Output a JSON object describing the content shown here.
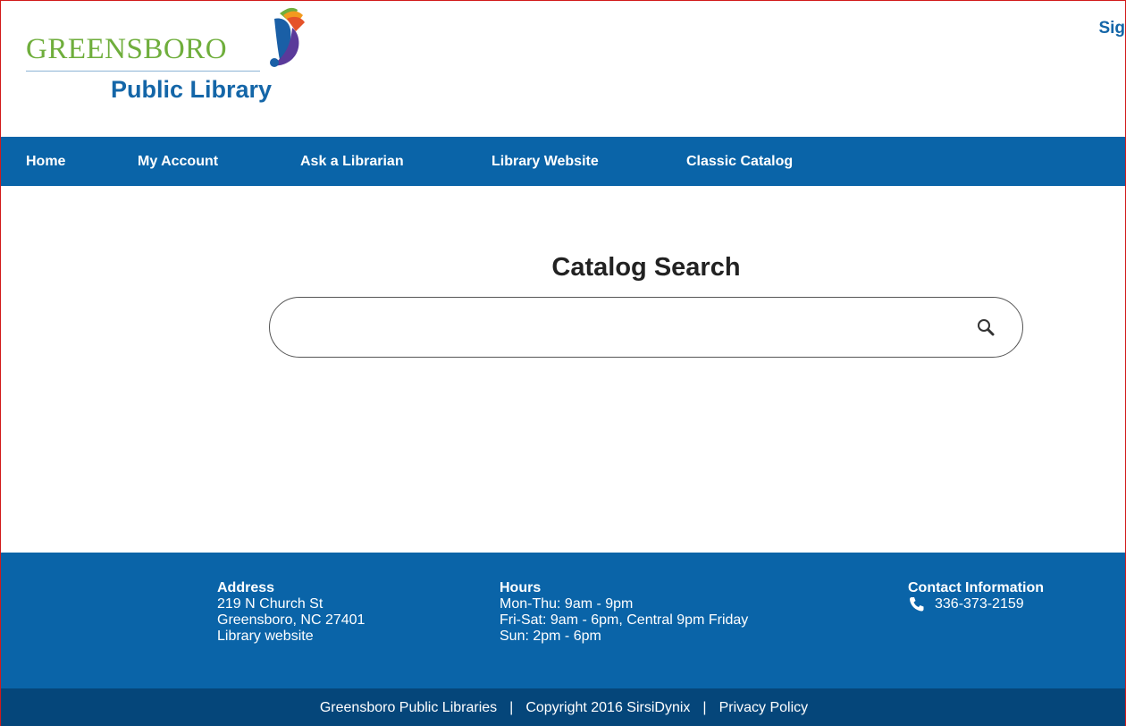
{
  "header": {
    "logo_top": "GREENSBORO",
    "logo_bottom": "Public Library",
    "signin_label": "Sig"
  },
  "nav": {
    "items": [
      {
        "label": "Home"
      },
      {
        "label": "My Account"
      },
      {
        "label": "Ask a Librarian"
      },
      {
        "label": "Library Website"
      },
      {
        "label": "Classic Catalog"
      }
    ]
  },
  "search": {
    "title": "Catalog Search",
    "value": "",
    "placeholder": ""
  },
  "footer": {
    "address": {
      "heading": "Address",
      "line1": "219 N Church St",
      "line2": "Greensboro, NC 27401",
      "link": "Library website"
    },
    "hours": {
      "heading": "Hours",
      "line1": "Mon-Thu: 9am - 9pm",
      "line2": "Fri-Sat: 9am - 6pm, Central 9pm Friday",
      "line3": "Sun: 2pm - 6pm"
    },
    "contact": {
      "heading": "Contact Information",
      "phone": "336-373-2159"
    },
    "bottom": {
      "org": "Greensboro Public Libraries",
      "separator": "|",
      "copyright": "Copyright 2016 SirsiDynix",
      "privacy": "Privacy Policy"
    }
  },
  "colors": {
    "primary_blue": "#0a64a8",
    "dark_blue": "#05467a",
    "logo_green": "#6fae3c",
    "logo_blue": "#1466a8"
  }
}
